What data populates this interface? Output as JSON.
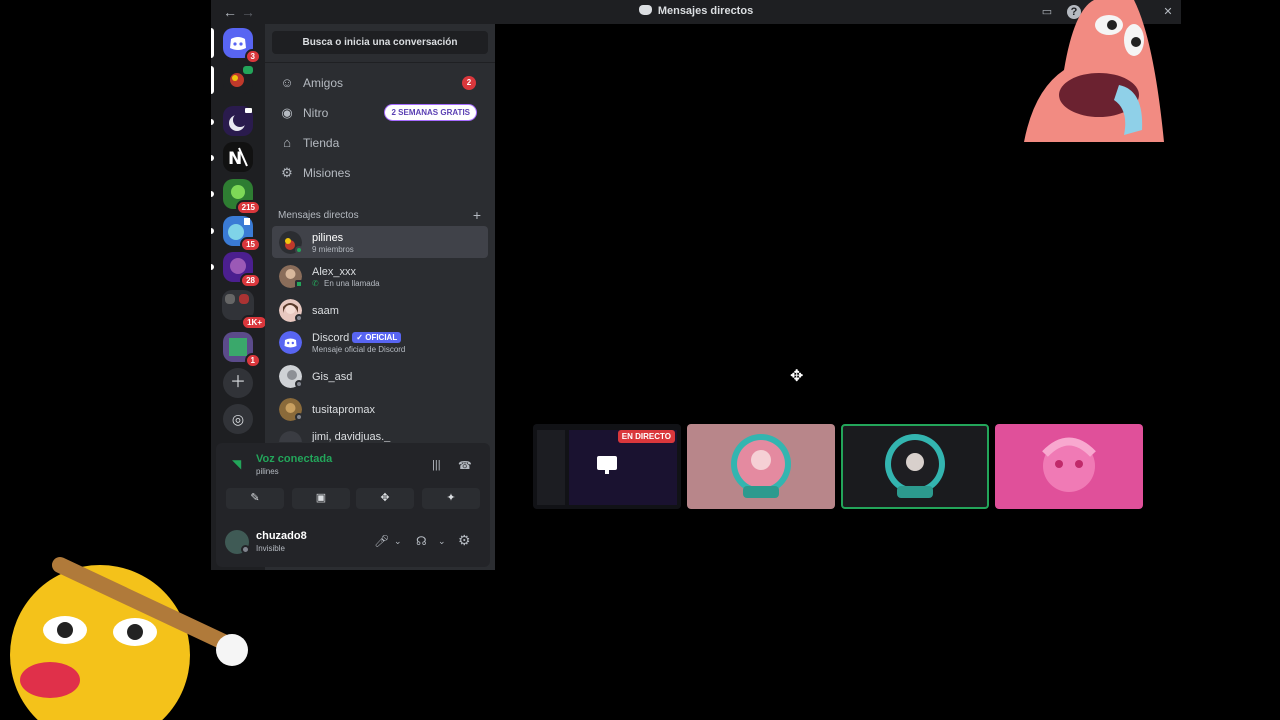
{
  "window": {
    "title": "Mensajes directos",
    "back": "←",
    "forward": "→"
  },
  "guilds": [
    {
      "badge": "3"
    },
    {
      "badge": ""
    },
    {
      "badge": ""
    },
    {
      "badge": ""
    },
    {
      "badge": "215"
    },
    {
      "badge": "15"
    },
    {
      "badge": "28"
    },
    {
      "badge": "1K+"
    },
    {
      "badge": "1"
    }
  ],
  "sidebar": {
    "search_label": "Busca o inicia una conversación",
    "nav": [
      {
        "label": "Amigos",
        "count": "2"
      },
      {
        "label": "Nitro",
        "promo": "2 SEMANAS GRATIS"
      },
      {
        "label": "Tienda"
      },
      {
        "label": "Misiones"
      }
    ],
    "dm_header": "Mensajes directos",
    "dms": [
      {
        "name": "pilines",
        "sub": "9 miembros"
      },
      {
        "name": "Alex_xxx",
        "sub": "En una llamada"
      },
      {
        "name": "saam",
        "sub": ""
      },
      {
        "name": "Discord",
        "tag": "✓ OFICIAL",
        "sub": "Mensaje oficial de Discord"
      },
      {
        "name": "Gis_asd",
        "sub": ""
      },
      {
        "name": "tusitapromax",
        "sub": ""
      },
      {
        "name": "jimi, davidjuas._",
        "sub": ""
      }
    ]
  },
  "voice": {
    "title": "Voz conectada",
    "channel": "pilines"
  },
  "user": {
    "name": "chuzado8",
    "status": "Invisible"
  },
  "stream": {
    "live_label": "EN DIRECTO"
  },
  "colors": {
    "accent": "#5865f2",
    "green": "#23a55a",
    "red": "#da373c"
  }
}
